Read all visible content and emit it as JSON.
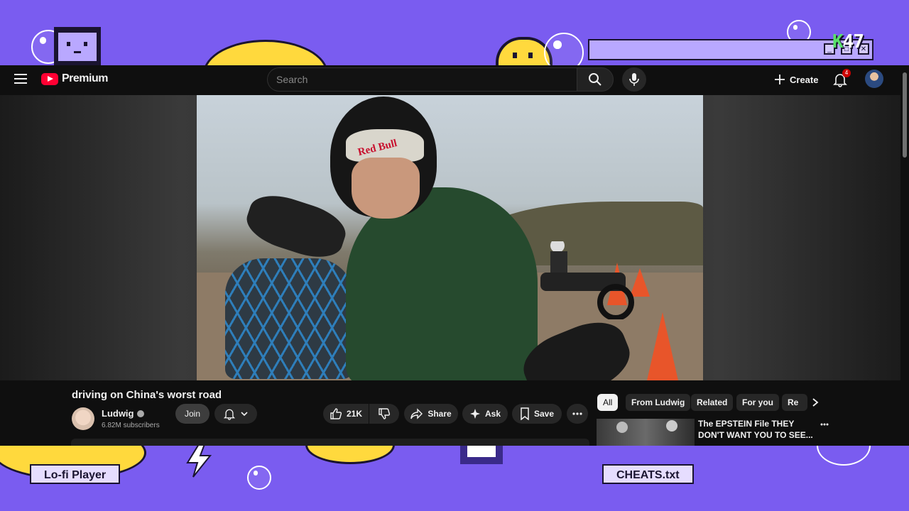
{
  "desktop": {
    "logo_text_k": "K",
    "logo_text_num": "47",
    "window_controls": [
      "_",
      "□",
      "✕"
    ],
    "label_left": "Lo-fi Player",
    "label_right": "CHEATS.txt"
  },
  "youtube": {
    "brand": "Premium",
    "search_placeholder": "Search",
    "create_label": "Create",
    "notifications_count": "4",
    "video": {
      "title": "driving on China's worst road",
      "channel": "Ludwig",
      "subscribers": "6.82M subscribers",
      "join_label": "Join",
      "likes": "21K",
      "share_label": "Share",
      "ask_label": "Ask",
      "save_label": "Save",
      "helmet_text": "Red Bull"
    },
    "chips": [
      "All",
      "From Ludwig",
      "Related",
      "For you",
      "Re"
    ],
    "recommended": {
      "title": "The EPSTEIN File THEY DON'T WANT YOU TO SEE..."
    }
  },
  "icons": [
    "menu-icon",
    "youtube-logo-icon",
    "search-icon",
    "mic-icon",
    "plus-icon",
    "bell-icon",
    "verified-icon",
    "bell-outline-icon",
    "chevron-down-icon",
    "like-icon",
    "dislike-icon",
    "share-icon",
    "sparkle-icon",
    "save-icon",
    "more-icon",
    "chevron-right-icon"
  ],
  "colors": {
    "desktop_bg": "#7a5cf0",
    "yt_bg": "#0f0f0f",
    "yt_red": "#ff0033",
    "chip_active": "#f1f1f1"
  }
}
